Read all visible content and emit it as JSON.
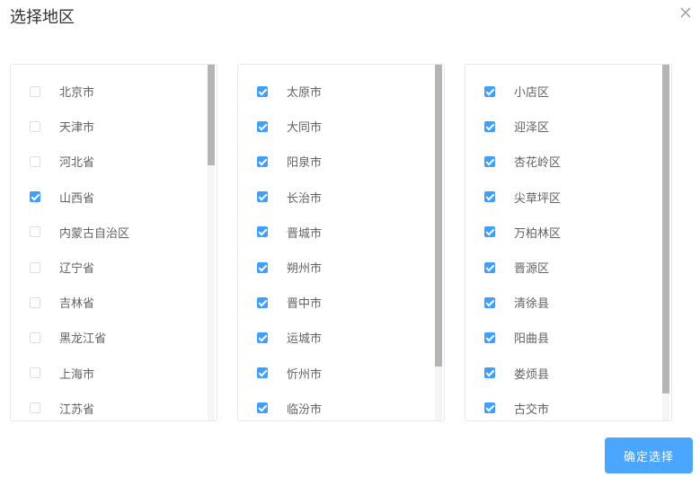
{
  "dialog": {
    "title": "选择地区",
    "confirm_label": "确定选择",
    "accent_color": "#409eff"
  },
  "panels": [
    {
      "name": "province",
      "scroll_position": 0.0,
      "items": [
        {
          "label": "北京市",
          "checked": false
        },
        {
          "label": "天津市",
          "checked": false
        },
        {
          "label": "河北省",
          "checked": false
        },
        {
          "label": "山西省",
          "checked": true
        },
        {
          "label": "内蒙古自治区",
          "checked": false
        },
        {
          "label": "辽宁省",
          "checked": false
        },
        {
          "label": "吉林省",
          "checked": false
        },
        {
          "label": "黑龙江省",
          "checked": false
        },
        {
          "label": "上海市",
          "checked": false
        },
        {
          "label": "江苏省",
          "checked": false
        }
      ]
    },
    {
      "name": "city",
      "scroll_position": 0.0,
      "items": [
        {
          "label": "太原市",
          "checked": true
        },
        {
          "label": "大同市",
          "checked": true
        },
        {
          "label": "阳泉市",
          "checked": true
        },
        {
          "label": "长治市",
          "checked": true
        },
        {
          "label": "晋城市",
          "checked": true
        },
        {
          "label": "朔州市",
          "checked": true
        },
        {
          "label": "晋中市",
          "checked": true
        },
        {
          "label": "运城市",
          "checked": true
        },
        {
          "label": "忻州市",
          "checked": true
        },
        {
          "label": "临汾市",
          "checked": true
        }
      ]
    },
    {
      "name": "district",
      "scroll_position": 0.0,
      "items": [
        {
          "label": "小店区",
          "checked": true
        },
        {
          "label": "迎泽区",
          "checked": true
        },
        {
          "label": "杏花岭区",
          "checked": true
        },
        {
          "label": "尖草坪区",
          "checked": true
        },
        {
          "label": "万柏林区",
          "checked": true
        },
        {
          "label": "晋源区",
          "checked": true
        },
        {
          "label": "清徐县",
          "checked": true
        },
        {
          "label": "阳曲县",
          "checked": true
        },
        {
          "label": "娄烦县",
          "checked": true
        },
        {
          "label": "古交市",
          "checked": true
        }
      ]
    }
  ]
}
